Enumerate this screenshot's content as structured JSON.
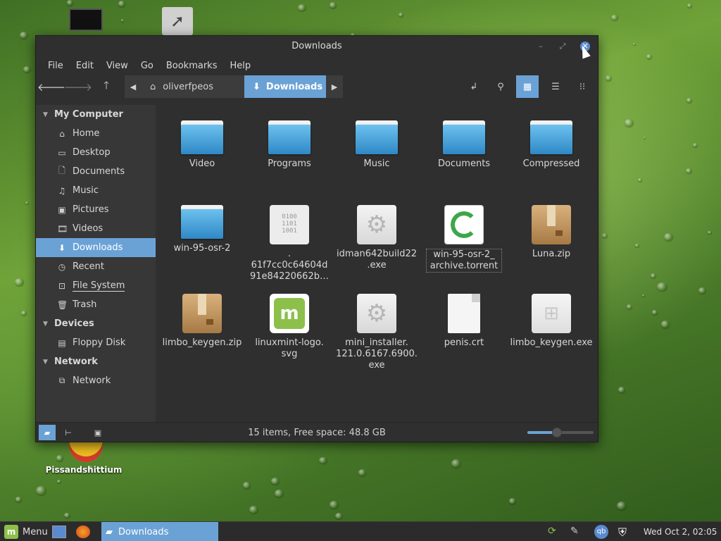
{
  "desktop": {
    "icons": [
      {
        "name": "computer",
        "label": ""
      },
      {
        "name": "home-folder",
        "label": ""
      },
      {
        "name": "chromium",
        "label": "Pissandshittium"
      }
    ]
  },
  "window": {
    "title": "Downloads",
    "menu": [
      "File",
      "Edit",
      "View",
      "Go",
      "Bookmarks",
      "Help"
    ],
    "toolbar": {
      "back_icon": "arrow-left-icon",
      "forward_icon": "arrow-right-icon",
      "up_icon": "arrow-up-icon",
      "path": [
        {
          "label": "oliverfpeos",
          "icon": "home-icon"
        },
        {
          "label": "Downloads",
          "icon": "download-icon"
        }
      ],
      "view_mode": "grid"
    },
    "sidebar": {
      "sections": [
        {
          "title": "My Computer",
          "items": [
            {
              "label": "Home",
              "icon": "home-icon"
            },
            {
              "label": "Desktop",
              "icon": "desktop-icon"
            },
            {
              "label": "Documents",
              "icon": "document-icon"
            },
            {
              "label": "Music",
              "icon": "music-icon"
            },
            {
              "label": "Pictures",
              "icon": "picture-icon"
            },
            {
              "label": "Videos",
              "icon": "video-icon"
            },
            {
              "label": "Downloads",
              "icon": "download-icon",
              "selected": true
            },
            {
              "label": "Recent",
              "icon": "clock-icon"
            },
            {
              "label": "File System",
              "icon": "drive-icon"
            },
            {
              "label": "Trash",
              "icon": "trash-icon"
            }
          ]
        },
        {
          "title": "Devices",
          "items": [
            {
              "label": "Floppy Disk",
              "icon": "floppy-icon"
            }
          ]
        },
        {
          "title": "Network",
          "items": [
            {
              "label": "Network",
              "icon": "network-icon"
            }
          ]
        }
      ]
    },
    "files": [
      {
        "label": "Video",
        "type": "folder"
      },
      {
        "label": "Programs",
        "type": "folder"
      },
      {
        "label": "Music",
        "type": "folder"
      },
      {
        "label": "Documents",
        "type": "folder"
      },
      {
        "label": "Compressed",
        "type": "folder"
      },
      {
        "label": "win-95-osr-2",
        "type": "folder"
      },
      {
        "label": ".\n61f7cc0c64604d\n91e84220662b…",
        "type": "binary"
      },
      {
        "label": "idman642build22\n.exe",
        "type": "executable"
      },
      {
        "label": "win-95-osr-2_\narchive.torrent",
        "type": "torrent"
      },
      {
        "label": "Luna.zip",
        "type": "zip"
      },
      {
        "label": "limbo_keygen.zip",
        "type": "zip"
      },
      {
        "label": "linuxmint-logo.\nsvg",
        "type": "svg"
      },
      {
        "label": "mini_installer.\n121.0.6167.6900.\nexe",
        "type": "executable"
      },
      {
        "label": "penis.crt",
        "type": "certificate"
      },
      {
        "label": "limbo_keygen.exe",
        "type": "windows-exe"
      }
    ],
    "status": "15 items, Free space: 48.8 GB",
    "zoom_level": 0.45
  },
  "taskbar": {
    "menu_label": "Menu",
    "task_label": "Downloads",
    "clock": "Wed Oct  2, 02:05"
  },
  "colors": {
    "accent": "#6ba2d6",
    "folder": "#3a92cf",
    "mint": "#8cc04b"
  }
}
